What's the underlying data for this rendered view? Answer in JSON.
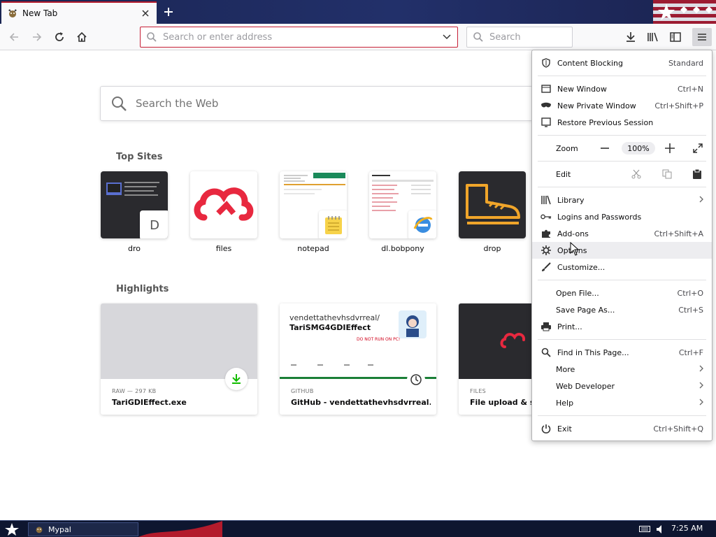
{
  "browser": {
    "tab": {
      "title": "New Tab"
    },
    "url_placeholder": "Search or enter address",
    "search_placeholder": "Search"
  },
  "newtab": {
    "search_placeholder": "Search the Web",
    "top_sites_title": "Top Sites",
    "top_sites": [
      {
        "label": "dro",
        "badge": "D"
      },
      {
        "label": "files"
      },
      {
        "label": "notepad"
      },
      {
        "label": "dl.bobpony"
      },
      {
        "label": "drop"
      }
    ],
    "highlights_title": "Highlights",
    "highlights": [
      {
        "context": "RAW — 297 KB",
        "title": "TariGDIEffect.exe"
      },
      {
        "context": "GITHUB",
        "title": "GitHub - vendettathevhsdvrreal...",
        "repo_owner": "vendettathevhsdvrreal/",
        "repo_name": "TariSMG4GDIEffect",
        "repo_desc": "DO NOT RUN ON PC!"
      },
      {
        "context": "FILES",
        "title": "File upload & sh"
      }
    ]
  },
  "menu": {
    "content_blocking": {
      "label": "Content Blocking",
      "value": "Standard"
    },
    "new_window": {
      "label": "New Window",
      "shortcut": "Ctrl+N"
    },
    "private_window": {
      "label": "New Private Window",
      "shortcut": "Ctrl+Shift+P"
    },
    "restore": {
      "label": "Restore Previous Session"
    },
    "zoom": {
      "label": "Zoom",
      "value": "100%"
    },
    "edit": {
      "label": "Edit"
    },
    "library": {
      "label": "Library"
    },
    "logins": {
      "label": "Logins and Passwords"
    },
    "addons": {
      "label": "Add-ons",
      "shortcut": "Ctrl+Shift+A"
    },
    "options": {
      "label": "Options"
    },
    "customize": {
      "label": "Customize..."
    },
    "open_file": {
      "label": "Open File...",
      "shortcut": "Ctrl+O"
    },
    "save_page": {
      "label": "Save Page As...",
      "shortcut": "Ctrl+S"
    },
    "print": {
      "label": "Print..."
    },
    "find": {
      "label": "Find in This Page...",
      "shortcut": "Ctrl+F"
    },
    "more": {
      "label": "More"
    },
    "web_developer": {
      "label": "Web Developer"
    },
    "help": {
      "label": "Help"
    },
    "exit": {
      "label": "Exit",
      "shortcut": "Ctrl+Shift+Q"
    }
  },
  "taskbar": {
    "task_label": "Mypal",
    "clock": "7:25 AM"
  },
  "colors": {
    "accent_red": "#c71f36",
    "download_green": "#12bc00",
    "tab_strip": "#1a2552"
  }
}
